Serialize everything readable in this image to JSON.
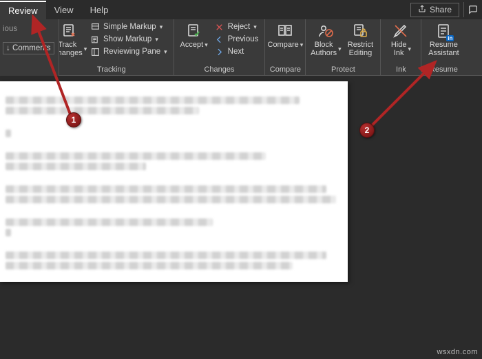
{
  "tabs": {
    "review": "Review",
    "view": "View",
    "help": "Help"
  },
  "share": "Share",
  "comments_fragment": {
    "top_cut": "ious",
    "button": "Comments"
  },
  "ribbon": {
    "track_changes": "Track\nChanges",
    "simple_markup": "Simple Markup",
    "show_markup": "Show Markup",
    "reviewing_pane": "Reviewing Pane",
    "group_tracking": "Tracking",
    "accept": "Accept",
    "reject": "Reject",
    "previous": "Previous",
    "next": "Next",
    "group_changes": "Changes",
    "compare": "Compare",
    "group_compare": "Compare",
    "block_authors": "Block\nAuthors",
    "restrict_editing": "Restrict\nEditing",
    "group_protect": "Protect",
    "hide_ink": "Hide\nInk",
    "group_ink": "Ink",
    "resume_assistant": "Resume\nAssistant",
    "group_resume": "Resume"
  },
  "callouts": {
    "one": "1",
    "two": "2"
  },
  "watermark": "wsxdn.com"
}
